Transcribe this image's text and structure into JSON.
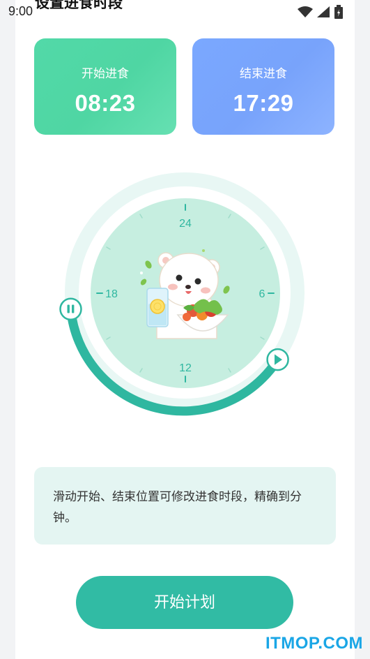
{
  "status_bar": {
    "time": "9:00",
    "icons": [
      "wifi-icon",
      "signal-icon",
      "battery-icon"
    ]
  },
  "header": {
    "title": "设置进食时段"
  },
  "start_card": {
    "label": "开始进食",
    "time": "08:23",
    "color": "#4fd6a3"
  },
  "end_card": {
    "label": "结束进食",
    "time": "17:29",
    "color": "#78a3fb"
  },
  "dial": {
    "labels": {
      "top": "24",
      "right": "6",
      "bottom": "12",
      "left": "18"
    },
    "track_color": "#e8f7f4",
    "face_color": "#c6eee0",
    "arc_color": "#2fb7a0",
    "illustration": "bear-with-salad-illustration"
  },
  "hint": {
    "text": "滑动开始、结束位置可修改进食时段，精确到分钟。"
  },
  "actions": {
    "start_plan": "开始计划"
  },
  "watermark": "ITMOP.COM"
}
